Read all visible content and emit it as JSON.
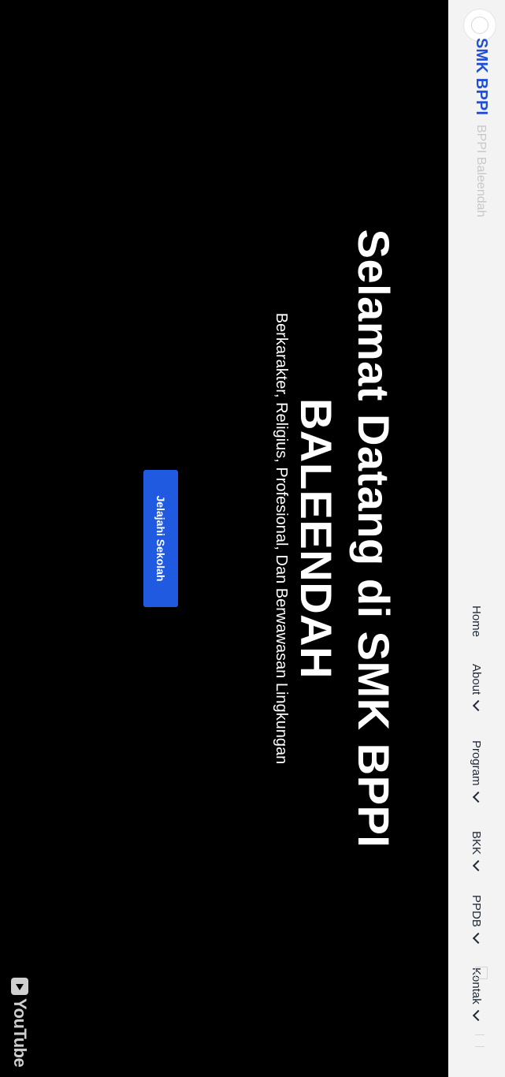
{
  "header": {
    "brand": "SMK BPPI",
    "brand_subtitle": "BPPI Baleendah",
    "nav": [
      {
        "label": "Home",
        "has_dropdown": false
      },
      {
        "label": "About",
        "has_dropdown": true
      },
      {
        "label": "Program",
        "has_dropdown": true
      },
      {
        "label": "BKK",
        "has_dropdown": true
      },
      {
        "label": "PPDB",
        "has_dropdown": true
      },
      {
        "label": "Kontak",
        "has_dropdown": true
      }
    ]
  },
  "hero": {
    "title_line1": "Selamat Datang di SMK BPPI",
    "title_line2": "BALEENDAH",
    "subtitle": "Berkarakter, Religius, Profesional, Dan Berwawasan Lingkungan",
    "cta_label": "Jelajahi Sekolah"
  },
  "video_overlay": {
    "provider_label": "YouTube"
  },
  "colors": {
    "brand_blue": "#1f4fd6",
    "cta_blue": "#1f5ae0",
    "navbar_bg": "#f3f3f3",
    "hero_bg": "#000000"
  }
}
